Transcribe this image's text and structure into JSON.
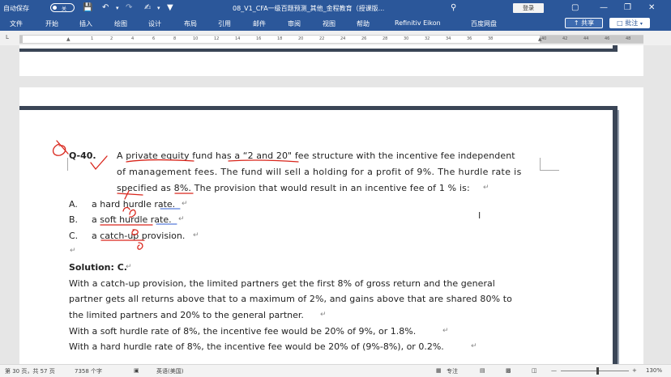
{
  "titlebar": {
    "autosave_label": "自动保存",
    "autosave_state": "关",
    "doc_title": "08_V1_CFA一级百题预测_其他_金程教育（授课版...",
    "search_placeholder": "",
    "login_label": "登录",
    "window_buttons": [
      "minimize-icon",
      "restore-icon",
      "close-icon"
    ]
  },
  "menubar": {
    "items": [
      "文件",
      "开始",
      "插入",
      "绘图",
      "设计",
      "布局",
      "引用",
      "邮件",
      "审阅",
      "视图",
      "帮助",
      "Refinitiv Eikon",
      "百度网盘"
    ],
    "share_label": "共享",
    "comment_label": "批注"
  },
  "ruler": {
    "labels": [
      "1",
      "2",
      "4",
      "6",
      "8",
      "10",
      "12",
      "14",
      "16",
      "18",
      "20",
      "22",
      "24",
      "26",
      "28",
      "30",
      "32",
      "34",
      "36",
      "38",
      "40",
      "42",
      "44",
      "46",
      "48"
    ]
  },
  "document": {
    "question_id": "Q-40.",
    "question_lines": [
      "A private equity fund has a “2 and 20\" fee structure with the incentive fee independent",
      "of management fees. The fund will sell a holding for a profit of 9%. The hurdle rate is",
      "specified as 8%. The provision that would result in an incentive fee of 1 % is:"
    ],
    "options": [
      {
        "letter": "A.",
        "text": "a hard hurdle rate."
      },
      {
        "letter": "B.",
        "text": "a soft hurdle rate."
      },
      {
        "letter": "C.",
        "text": "a catch-up provision."
      }
    ],
    "solution_label": "Solution: C.",
    "solution_lines": [
      "With a catch-up provision, the limited partners get the first 8% of gross return and the general",
      "partner gets all returns above that to a maximum of 2%, and gains above that are shared 80% to",
      "the limited partners and 20% to the general partner.",
      "With a soft hurdle rate of 8%, the incentive fee would be 20% of 9%, or 1.8%.",
      "With a hard hurdle rate of 8%, the incentive fee would be 20% of (9%-8%), or 0.2%."
    ],
    "paragraph_mark": "↵"
  },
  "statusbar": {
    "page_info": "第 30 页，共 57 页",
    "word_count": "7358 个字",
    "language": "英语(美国)",
    "focus_label": "专注",
    "zoom": "130%"
  },
  "colors": {
    "ribbon_blue": "#2b579a",
    "ink_red": "#d9261c",
    "ink_blue": "#2c5bd1"
  }
}
